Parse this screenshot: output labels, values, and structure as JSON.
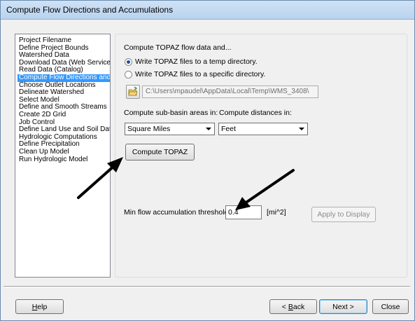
{
  "window": {
    "title": "Compute Flow Directions and Accumulations"
  },
  "steps": [
    "Project Filename",
    "Define Project Bounds",
    "Watershed Data",
    "Download Data (Web Service",
    "Read Data (Catalog)",
    "Compute Flow Directions and",
    "Choose Outlet Locations",
    "Delineate Watershed",
    "Select Model",
    "Define and Smooth Streams",
    "Create 2D Grid",
    "Job Control",
    "Define Land Use and Soil Dat",
    "Hydrologic Computations",
    "Define Precipitation",
    "Clean Up Model",
    "Run Hydrologic Model"
  ],
  "selected_step_index": 5,
  "main": {
    "heading": "Compute TOPAZ flow data and...",
    "radio_temp": "Write TOPAZ files to a temp directory.",
    "radio_specific": "Write TOPAZ files to a specific directory.",
    "radio_selected": "temp",
    "path_value": "C:\\Users\\mpaudel\\AppData\\Local\\Temp\\WMS_3408\\",
    "subbasin_label": "Compute sub-basin areas in:",
    "distances_label": "Compute distances in:",
    "subbasin_value": "Square Miles",
    "distances_value": "Feet",
    "compute_button": "Compute TOPAZ",
    "threshold_label": "Min flow accumulation threshold:",
    "threshold_value": "0.4",
    "threshold_unit": "[mi^2]",
    "apply_button": "Apply to Display"
  },
  "footer": {
    "help_hotkey": "H",
    "help_rest": "elp",
    "back_prefix": "< ",
    "back_hotkey": "B",
    "back_rest": "ack",
    "next": "Next >",
    "close": "Close"
  },
  "colors": {
    "selection": "#3399ff",
    "annotation_arrows": "#000000"
  },
  "icons": {
    "folder_button": "folder-open-icon"
  }
}
